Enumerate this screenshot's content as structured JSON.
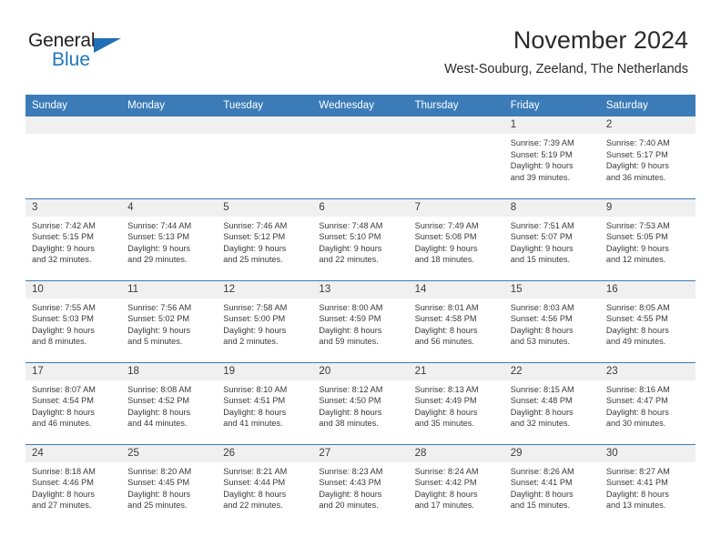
{
  "brand": {
    "name_part1": "General",
    "name_part2": "Blue",
    "accent_color": "#1f6fb5"
  },
  "header": {
    "title": "November 2024",
    "subtitle": "West-Souburg, Zeeland, The Netherlands",
    "header_bg": "#3b7cb8",
    "daynum_bg": "#f0f0f0"
  },
  "weekdays": [
    "Sunday",
    "Monday",
    "Tuesday",
    "Wednesday",
    "Thursday",
    "Friday",
    "Saturday"
  ],
  "weeks": [
    [
      {
        "day": ""
      },
      {
        "day": ""
      },
      {
        "day": ""
      },
      {
        "day": ""
      },
      {
        "day": ""
      },
      {
        "day": "1",
        "sunrise": "Sunrise: 7:39 AM",
        "sunset": "Sunset: 5:19 PM",
        "daylight1": "Daylight: 9 hours",
        "daylight2": "and 39 minutes."
      },
      {
        "day": "2",
        "sunrise": "Sunrise: 7:40 AM",
        "sunset": "Sunset: 5:17 PM",
        "daylight1": "Daylight: 9 hours",
        "daylight2": "and 36 minutes."
      }
    ],
    [
      {
        "day": "3",
        "sunrise": "Sunrise: 7:42 AM",
        "sunset": "Sunset: 5:15 PM",
        "daylight1": "Daylight: 9 hours",
        "daylight2": "and 32 minutes."
      },
      {
        "day": "4",
        "sunrise": "Sunrise: 7:44 AM",
        "sunset": "Sunset: 5:13 PM",
        "daylight1": "Daylight: 9 hours",
        "daylight2": "and 29 minutes."
      },
      {
        "day": "5",
        "sunrise": "Sunrise: 7:46 AM",
        "sunset": "Sunset: 5:12 PM",
        "daylight1": "Daylight: 9 hours",
        "daylight2": "and 25 minutes."
      },
      {
        "day": "6",
        "sunrise": "Sunrise: 7:48 AM",
        "sunset": "Sunset: 5:10 PM",
        "daylight1": "Daylight: 9 hours",
        "daylight2": "and 22 minutes."
      },
      {
        "day": "7",
        "sunrise": "Sunrise: 7:49 AM",
        "sunset": "Sunset: 5:08 PM",
        "daylight1": "Daylight: 9 hours",
        "daylight2": "and 18 minutes."
      },
      {
        "day": "8",
        "sunrise": "Sunrise: 7:51 AM",
        "sunset": "Sunset: 5:07 PM",
        "daylight1": "Daylight: 9 hours",
        "daylight2": "and 15 minutes."
      },
      {
        "day": "9",
        "sunrise": "Sunrise: 7:53 AM",
        "sunset": "Sunset: 5:05 PM",
        "daylight1": "Daylight: 9 hours",
        "daylight2": "and 12 minutes."
      }
    ],
    [
      {
        "day": "10",
        "sunrise": "Sunrise: 7:55 AM",
        "sunset": "Sunset: 5:03 PM",
        "daylight1": "Daylight: 9 hours",
        "daylight2": "and 8 minutes."
      },
      {
        "day": "11",
        "sunrise": "Sunrise: 7:56 AM",
        "sunset": "Sunset: 5:02 PM",
        "daylight1": "Daylight: 9 hours",
        "daylight2": "and 5 minutes."
      },
      {
        "day": "12",
        "sunrise": "Sunrise: 7:58 AM",
        "sunset": "Sunset: 5:00 PM",
        "daylight1": "Daylight: 9 hours",
        "daylight2": "and 2 minutes."
      },
      {
        "day": "13",
        "sunrise": "Sunrise: 8:00 AM",
        "sunset": "Sunset: 4:59 PM",
        "daylight1": "Daylight: 8 hours",
        "daylight2": "and 59 minutes."
      },
      {
        "day": "14",
        "sunrise": "Sunrise: 8:01 AM",
        "sunset": "Sunset: 4:58 PM",
        "daylight1": "Daylight: 8 hours",
        "daylight2": "and 56 minutes."
      },
      {
        "day": "15",
        "sunrise": "Sunrise: 8:03 AM",
        "sunset": "Sunset: 4:56 PM",
        "daylight1": "Daylight: 8 hours",
        "daylight2": "and 53 minutes."
      },
      {
        "day": "16",
        "sunrise": "Sunrise: 8:05 AM",
        "sunset": "Sunset: 4:55 PM",
        "daylight1": "Daylight: 8 hours",
        "daylight2": "and 49 minutes."
      }
    ],
    [
      {
        "day": "17",
        "sunrise": "Sunrise: 8:07 AM",
        "sunset": "Sunset: 4:54 PM",
        "daylight1": "Daylight: 8 hours",
        "daylight2": "and 46 minutes."
      },
      {
        "day": "18",
        "sunrise": "Sunrise: 8:08 AM",
        "sunset": "Sunset: 4:52 PM",
        "daylight1": "Daylight: 8 hours",
        "daylight2": "and 44 minutes."
      },
      {
        "day": "19",
        "sunrise": "Sunrise: 8:10 AM",
        "sunset": "Sunset: 4:51 PM",
        "daylight1": "Daylight: 8 hours",
        "daylight2": "and 41 minutes."
      },
      {
        "day": "20",
        "sunrise": "Sunrise: 8:12 AM",
        "sunset": "Sunset: 4:50 PM",
        "daylight1": "Daylight: 8 hours",
        "daylight2": "and 38 minutes."
      },
      {
        "day": "21",
        "sunrise": "Sunrise: 8:13 AM",
        "sunset": "Sunset: 4:49 PM",
        "daylight1": "Daylight: 8 hours",
        "daylight2": "and 35 minutes."
      },
      {
        "day": "22",
        "sunrise": "Sunrise: 8:15 AM",
        "sunset": "Sunset: 4:48 PM",
        "daylight1": "Daylight: 8 hours",
        "daylight2": "and 32 minutes."
      },
      {
        "day": "23",
        "sunrise": "Sunrise: 8:16 AM",
        "sunset": "Sunset: 4:47 PM",
        "daylight1": "Daylight: 8 hours",
        "daylight2": "and 30 minutes."
      }
    ],
    [
      {
        "day": "24",
        "sunrise": "Sunrise: 8:18 AM",
        "sunset": "Sunset: 4:46 PM",
        "daylight1": "Daylight: 8 hours",
        "daylight2": "and 27 minutes."
      },
      {
        "day": "25",
        "sunrise": "Sunrise: 8:20 AM",
        "sunset": "Sunset: 4:45 PM",
        "daylight1": "Daylight: 8 hours",
        "daylight2": "and 25 minutes."
      },
      {
        "day": "26",
        "sunrise": "Sunrise: 8:21 AM",
        "sunset": "Sunset: 4:44 PM",
        "daylight1": "Daylight: 8 hours",
        "daylight2": "and 22 minutes."
      },
      {
        "day": "27",
        "sunrise": "Sunrise: 8:23 AM",
        "sunset": "Sunset: 4:43 PM",
        "daylight1": "Daylight: 8 hours",
        "daylight2": "and 20 minutes."
      },
      {
        "day": "28",
        "sunrise": "Sunrise: 8:24 AM",
        "sunset": "Sunset: 4:42 PM",
        "daylight1": "Daylight: 8 hours",
        "daylight2": "and 17 minutes."
      },
      {
        "day": "29",
        "sunrise": "Sunrise: 8:26 AM",
        "sunset": "Sunset: 4:41 PM",
        "daylight1": "Daylight: 8 hours",
        "daylight2": "and 15 minutes."
      },
      {
        "day": "30",
        "sunrise": "Sunrise: 8:27 AM",
        "sunset": "Sunset: 4:41 PM",
        "daylight1": "Daylight: 8 hours",
        "daylight2": "and 13 minutes."
      }
    ]
  ]
}
